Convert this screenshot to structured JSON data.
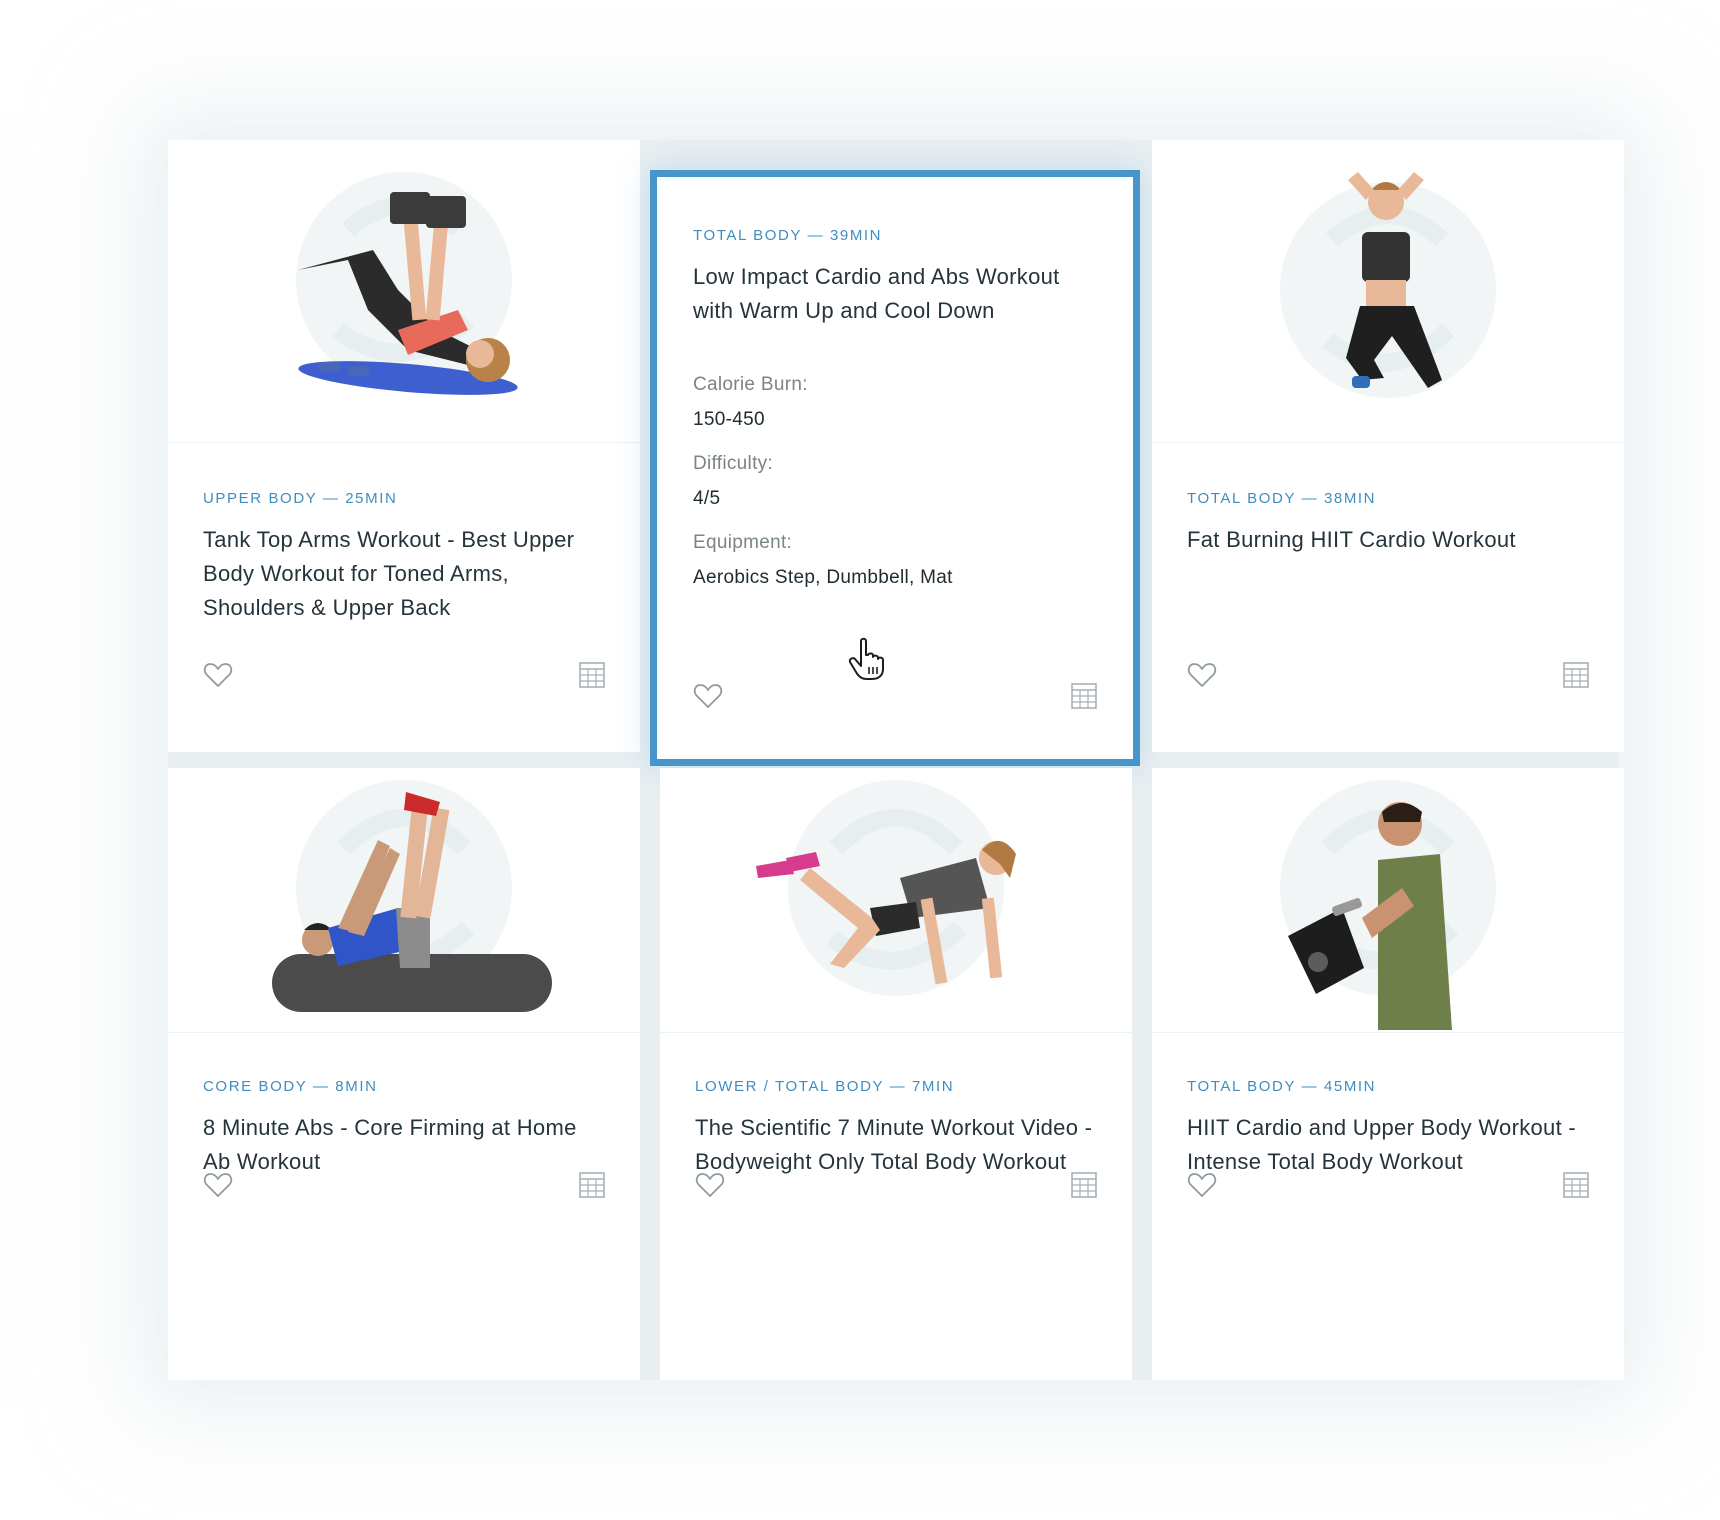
{
  "workouts": [
    {
      "meta": "UPPER BODY — 25MIN",
      "title": "Tank Top Arms Workout - Best Upper Body Workout for Toned Arms, Shoulders & Upper Back"
    },
    {
      "meta": "TOTAL BODY — 39MIN",
      "title": "Low Impact Cardio and Abs Workout with Warm Up and Cool Down",
      "calorie_label": "Calorie Burn:",
      "calorie_value": "150-450",
      "difficulty_label": "Difficulty:",
      "difficulty_value": "4/5",
      "equipment_label": "Equipment:",
      "equipment_value": "Aerobics Step, Dumbbell, Mat"
    },
    {
      "meta": "TOTAL BODY — 38MIN",
      "title": "Fat Burning HIIT Cardio Workout"
    },
    {
      "meta": "CORE BODY — 8MIN",
      "title": "8 Minute Abs - Core Firming at Home Ab Workout"
    },
    {
      "meta": "LOWER / TOTAL BODY — 7MIN",
      "title": "The Scientific 7 Minute Workout Video - Bodyweight Only Total Body Workout"
    },
    {
      "meta": "TOTAL BODY — 45MIN",
      "title": "HIIT Cardio and Upper Body Workout - Intense Total Body Workout"
    }
  ],
  "icons": {
    "favorite": "heart-icon",
    "schedule": "grid-icon",
    "cursor": "hand-cursor-icon"
  },
  "colors": {
    "accent": "#3f8dbf",
    "highlight_border": "#4796cb",
    "title_text": "#25343b"
  }
}
